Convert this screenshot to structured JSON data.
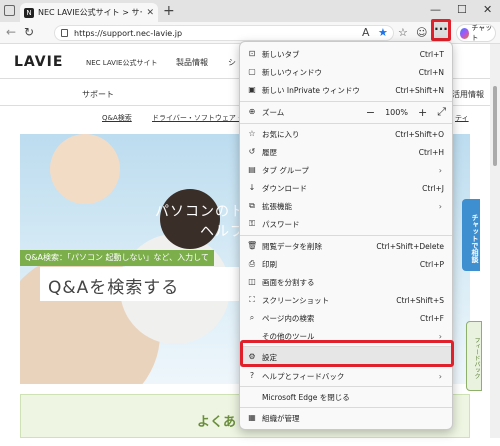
{
  "browser": {
    "tab_title": "NEC LAVIE公式サイト > サービス＆サ",
    "url": "https://support.nec-lavie.jp",
    "copilot_label": "チャット"
  },
  "site": {
    "logo": "LAVIE",
    "logo_sub": "NEC LAVIE公式サイト",
    "nav": [
      "製品情報",
      "シ"
    ],
    "subnav_left": "サポート",
    "subnav_right": "活用情報",
    "links": [
      "Q&A検索",
      "ドライバー・ソフトウェア ダ",
      "ティ"
    ],
    "hero_line1": "パソコンのトラ",
    "hero_line2": "ヘルプ情報",
    "qa_label": "Q&A検索：「パソコン 起動しない」など、入力して",
    "qa_title": "Q&Aを検索する",
    "bottom_title": "よくあ",
    "side_chat": "チャットで相談",
    "side_feedback": "フィードバック"
  },
  "menu": {
    "items": [
      {
        "label": "新しいタブ",
        "shortcut": "Ctrl+T",
        "icon": "new-tab-icon"
      },
      {
        "label": "新しいウィンドウ",
        "shortcut": "Ctrl+N",
        "icon": "new-window-icon"
      },
      {
        "label": "新しい InPrivate ウィンドウ",
        "shortcut": "Ctrl+Shift+N",
        "icon": "inprivate-icon"
      },
      {
        "label": "ズーム",
        "zoom": "100%",
        "icon": "zoom-icon"
      },
      {
        "label": "お気に入り",
        "shortcut": "Ctrl+Shift+O",
        "icon": "favorites-icon"
      },
      {
        "label": "履歴",
        "shortcut": "Ctrl+H",
        "icon": "history-icon"
      },
      {
        "label": "タブ グループ",
        "submenu": true,
        "icon": "tab-groups-icon"
      },
      {
        "label": "ダウンロード",
        "shortcut": "Ctrl+J",
        "icon": "download-icon"
      },
      {
        "label": "拡張機能",
        "submenu": true,
        "icon": "extensions-icon"
      },
      {
        "label": "パスワード",
        "icon": "password-icon"
      },
      {
        "label": "閲覧データを削除",
        "shortcut": "Ctrl+Shift+Delete",
        "icon": "clear-data-icon"
      },
      {
        "label": "印刷",
        "shortcut": "Ctrl+P",
        "icon": "print-icon"
      },
      {
        "label": "画面を分割する",
        "icon": "split-screen-icon"
      },
      {
        "label": "スクリーンショット",
        "shortcut": "Ctrl+Shift+S",
        "icon": "screenshot-icon"
      },
      {
        "label": "ページ内の検索",
        "shortcut": "Ctrl+F",
        "icon": "find-icon"
      },
      {
        "label": "その他のツール",
        "submenu": true,
        "icon": ""
      },
      {
        "label": "設定",
        "icon": "settings-icon"
      },
      {
        "label": "ヘルプとフィードバック",
        "submenu": true,
        "icon": "help-icon"
      },
      {
        "label": "Microsoft Edge を閉じる",
        "icon": ""
      },
      {
        "label": "組織が管理",
        "icon": "organization-icon"
      }
    ]
  },
  "colors": {
    "highlight_red": "#e0202a",
    "accent_green": "#7cae4c",
    "accent_blue": "#3e8fd0"
  }
}
